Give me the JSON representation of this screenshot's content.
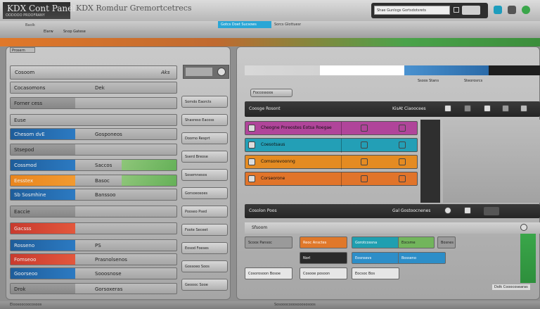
{
  "app": {
    "title": "KDX Cont Panel",
    "subtitle": "OODOOO PROOFRANY",
    "header_text": "KDX Romdur Gremortcetrecs",
    "search_placeholder": "Shae Gunlogs Gortsdotsrets"
  },
  "tabs": {
    "t1": "Baolk",
    "t2": "Elarw",
    "t3": "Snop Gatese",
    "active": "Gotcs Doet Sucsows",
    "t5": "Sorcs Glottuesr"
  },
  "left": {
    "header": "Prosern",
    "search_label": "Cosoom",
    "search_value": "Aks",
    "rows": [
      {
        "label": "Cocasomons",
        "value": "Dek"
      },
      {
        "label": "Forner cess",
        "value": ""
      },
      {
        "label": "Euse",
        "value": ""
      },
      {
        "label": "Chesom dvE",
        "value": "Gosponeos"
      },
      {
        "label": "Stsepod",
        "value": ""
      },
      {
        "label": "Cossmod",
        "value": "Saccos"
      },
      {
        "label": "Eesstex",
        "value": "Basoc"
      },
      {
        "label": "Sb Sosmhine",
        "value": "Banssoo"
      },
      {
        "label": "Eaccie",
        "value": ""
      },
      {
        "label": "Gacsss",
        "value": ""
      },
      {
        "label": "Rosseno",
        "value": "PS"
      },
      {
        "label": "Fomseoo",
        "value": "Prasnolsenos"
      },
      {
        "label": "Goorseoo",
        "value": "Sooosnose"
      },
      {
        "label": "Drok",
        "value": "Gorsoxeras"
      }
    ],
    "side": [
      "Somdo Eaorcts",
      "Shasreso Eacoss",
      "Doomo Resprt",
      "Sserd Breose",
      "Sosemnesos",
      "Gorsoeosoes",
      "Pooseo Psed",
      "Foote Seceet",
      "Eosod Foeses",
      "Gossoeo Soos",
      "Geoooc Sooe"
    ]
  },
  "right": {
    "breadcrumb": "Foccossoos",
    "tools": [
      "Ssoos Stans",
      "Steorosrcs"
    ],
    "dark_header": "Coosge Rosont",
    "dark_header_right": "KisAt Ciaoocees",
    "cards": [
      {
        "label": "Cheogne Pnreostes Eotsa Roegae",
        "color": "#b0459a"
      },
      {
        "label": "Coesotsaus",
        "color": "#239fb6"
      },
      {
        "label": "Comsorevoonng",
        "color": "#e48b22"
      },
      {
        "label": "Corseorone",
        "color": "#e1742a"
      }
    ],
    "dark_footer": "Cosolon Poos",
    "dark_footer_right": "Gal Gostoocnenes",
    "sub_header": "Sfsoom",
    "tiles": [
      {
        "label": "Scoox Pansoc",
        "color": "#9a9a9a"
      },
      {
        "label": "Reoc Ansctes",
        "color": "#e0782a"
      },
      {
        "label": "Gorotcossna",
        "color": "#1f9fb0"
      },
      {
        "label": "Eocsme",
        "color": "#72b55c"
      },
      {
        "label": "Bosnes",
        "color": "#9a9a9a"
      },
      {
        "label": "Norl",
        "color": "#2a2a2a"
      },
      {
        "label": "Eosnsevs",
        "color": "#2d8ec8"
      },
      {
        "label": "Bosseno",
        "color": "#2d8ec8"
      },
      {
        "label": "Cosorosoon Bosoe",
        "color": "#e6e6e6"
      },
      {
        "label": "Cosooe posoon",
        "color": "#e6e6e6"
      },
      {
        "label": "Eocsoc Bos",
        "color": "#e6e6e6"
      }
    ],
    "footer_right": "Dolk Cooocosearas"
  },
  "footer": {
    "left": "Eloosoocoocosoos",
    "center": "Sosooocooosooososoos"
  }
}
